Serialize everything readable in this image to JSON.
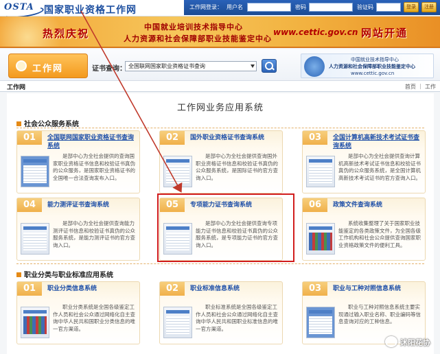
{
  "header": {
    "logo": "OSTA",
    "site_name": "国家职业资格工作网",
    "login": {
      "label": "工作网登录：",
      "username_label": "用户名",
      "password_label": "密码",
      "captcha_label": "验证码",
      "login_button": "登录",
      "register_button": "注册"
    }
  },
  "banner": {
    "left": "热烈庆祝",
    "center_line1": "中国就业培训技术指导中心",
    "center_line2": "人力资源和社会保障部职业技能鉴定中心",
    "url": "www.cettic.gov.cn",
    "right": "网站开通"
  },
  "search": {
    "tab_label": "工作网",
    "label": "证书查询：",
    "select_value": "全国联网国家职业资格证书查询"
  },
  "right_banner": {
    "line1": "中国就业技术指导中心",
    "line2": "人力资源和社会保障部职业技能鉴定中心",
    "line3": "www.cettic.gov.cn"
  },
  "breadcrumb": {
    "left": "工作网",
    "right": "首页 ｜ 工作"
  },
  "main": {
    "title": "工作网业务应用系统",
    "section1": "社会公众服务系统",
    "section2": "职业分类与职业标准应用系统",
    "cards": [
      {
        "num": "01",
        "title": "全国联网国家职业资格证书查询系统",
        "desc": "是部中心为全社会提供的查询国家职业资格证书信息和校验证书真伪的公众服务，是国家职业资格证书的全国唯一合法查询发布入口。"
      },
      {
        "num": "02",
        "title": "国外职业资格证书查询系统",
        "desc": "是部中心为全社会提供查询国外职业资格证书信息和校验证书真伪的公众服务系统，是国际证书的官方查询入口。"
      },
      {
        "num": "03",
        "title": "全国计算机高新技术考试证书查询系统",
        "desc": "是部中心为全社会提供查询计算机高新技术考试证书信息和校验证书真伪的公众服务系统，是全国计算机高新技术考试证书的官方查询入口。"
      },
      {
        "num": "04",
        "title": "能力测评证书查询系统",
        "desc": "是部中心为全社会提供查询能力测评证书信息和校验证书真伪的公众服务系统，是能力测评证书的官方查询入口。"
      },
      {
        "num": "05",
        "title": "专项能力证书查询系统",
        "desc": "是部中心为全社会提供查询专项能力证书信息和校验证书真伪的公众服务系统，是专项能力证书的官方查询入口。"
      },
      {
        "num": "06",
        "title": "政策文件查询系统",
        "desc": "系统收集整理了关于国家职业技能鉴定的各类政策文件，为全国各级工作机构和社会公众提供查询国家职业资格政策文件的便利工具。"
      },
      {
        "num": "01",
        "title": "职业分类信息系统",
        "desc": "职业分类系统是全国各级鉴定工作人员和社会公众通过网络化自主查询中华人民共和国职业分类信息的唯一官方渠道。"
      },
      {
        "num": "02",
        "title": "职业标准信息系统",
        "desc": "职业标准系统是全国各级鉴定工作人员和社会公众通过网络化自主查询中华人民共和国职业标准信息的唯一官方渠道。"
      },
      {
        "num": "03",
        "title": "职业与工种对照信息系统",
        "desc": "职业与工种对照信息系统主要实现通过输入职业名称、职业编码等信息查询对应的工种信息。"
      }
    ]
  },
  "watermark": "沭阳花协",
  "colors": {
    "accent_red": "#d11c1c",
    "link_blue": "#1e4fa8",
    "orange": "#f39a1e"
  }
}
